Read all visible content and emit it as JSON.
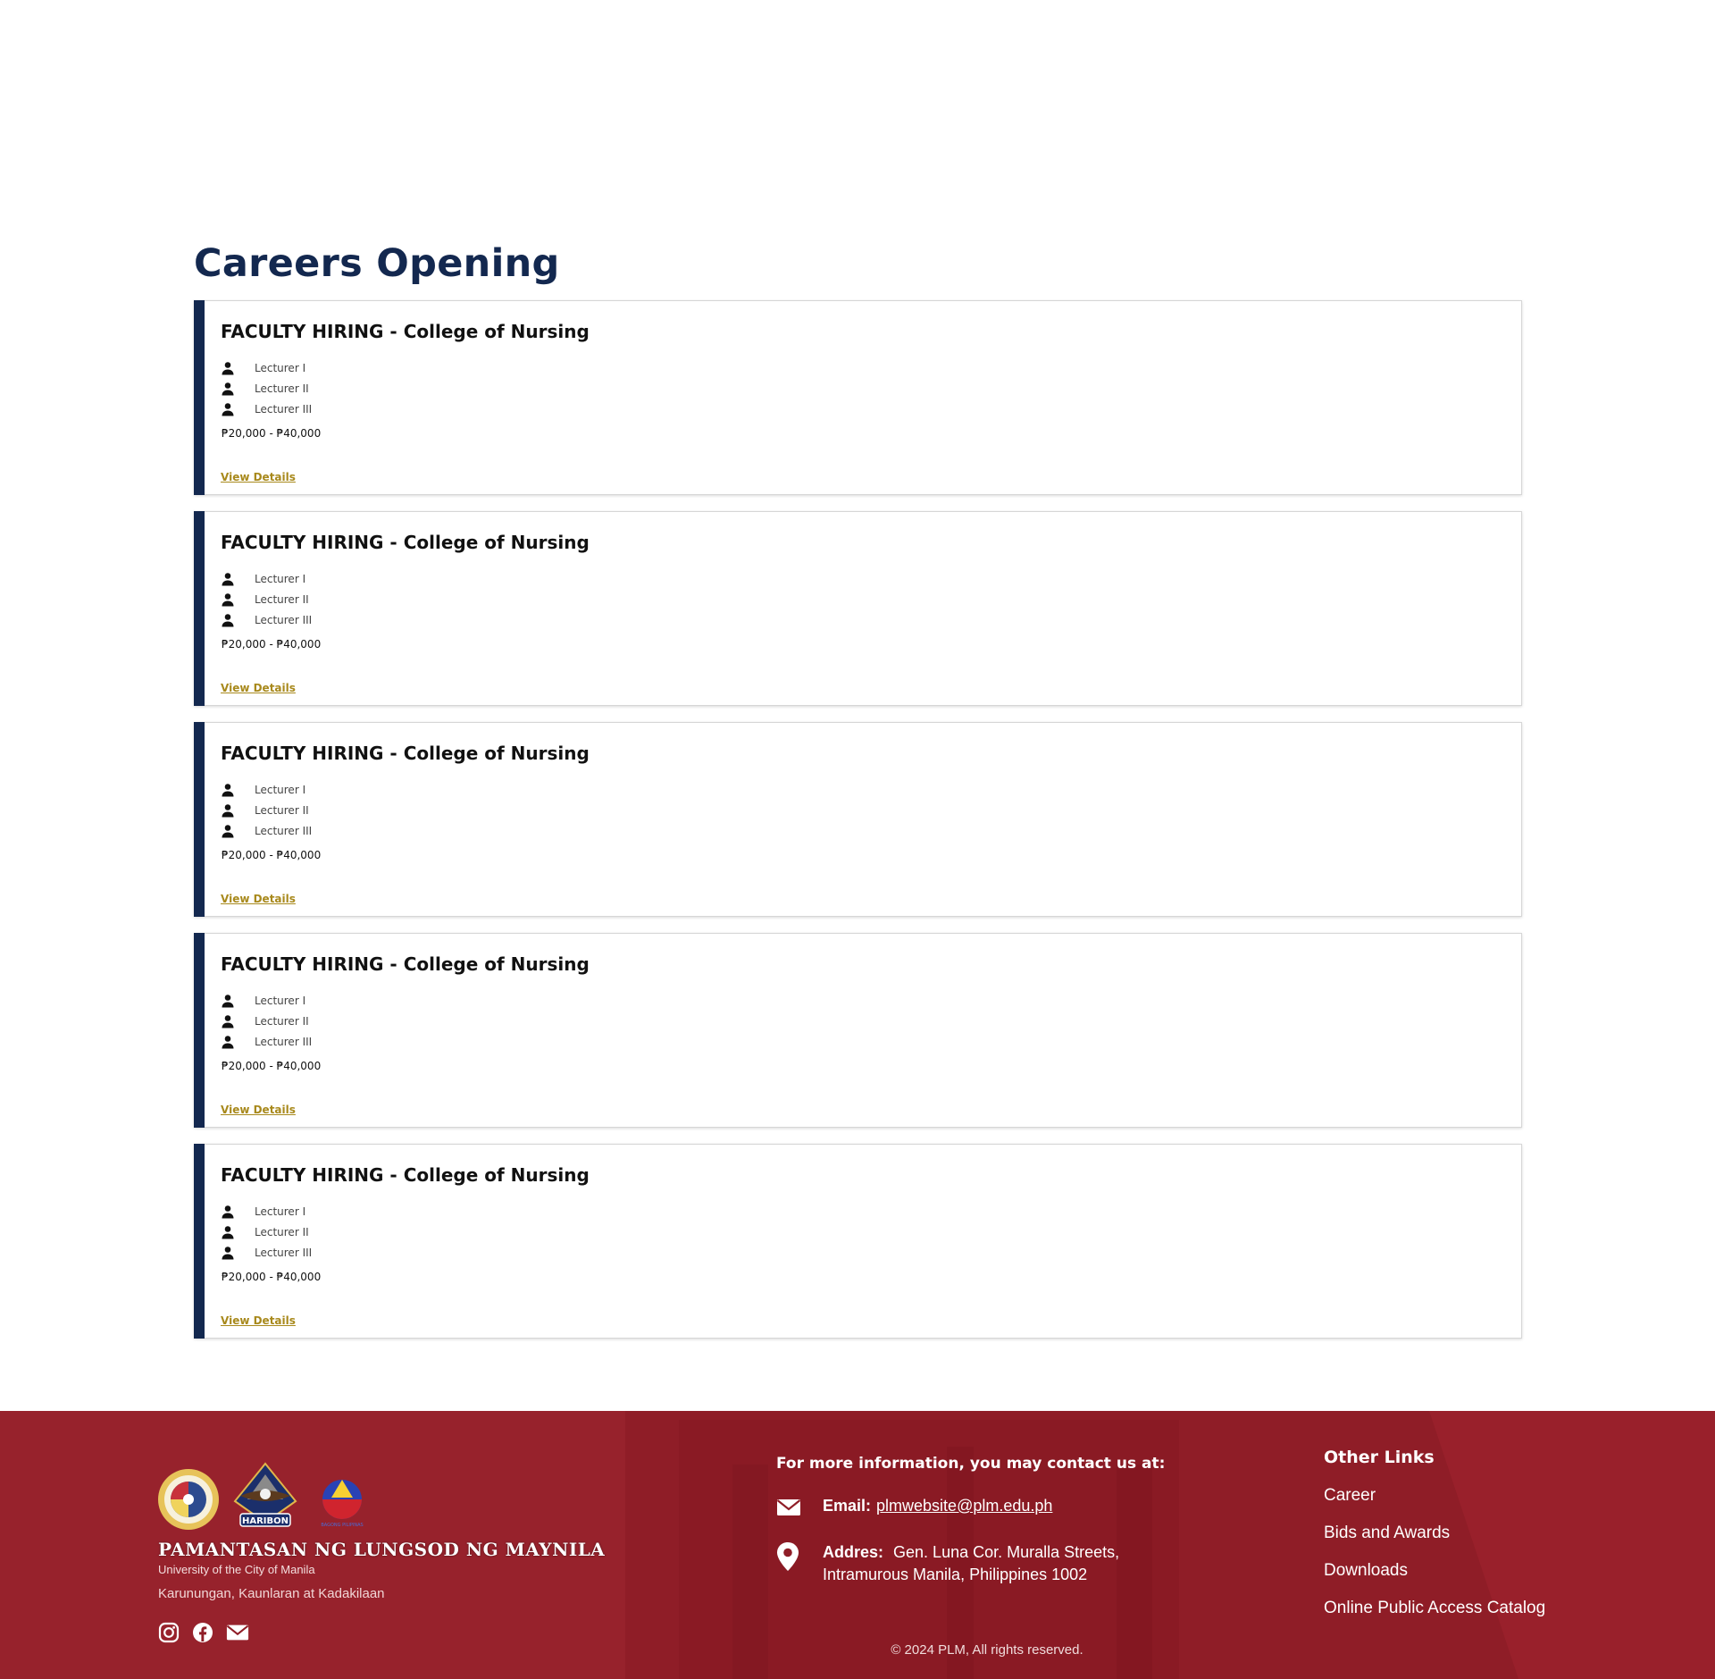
{
  "page": {
    "title": "Careers Opening"
  },
  "jobs": [
    {
      "title": "FACULTY HIRING - College of Nursing",
      "positions": [
        "Lecturer I",
        "Lecturer II",
        "Lecturer III"
      ],
      "salary": "₱20,000 - ₱40,000",
      "link_label": "View Details"
    },
    {
      "title": "FACULTY HIRING - College of Nursing",
      "positions": [
        "Lecturer I",
        "Lecturer II",
        "Lecturer III"
      ],
      "salary": "₱20,000 - ₱40,000",
      "link_label": "View Details"
    },
    {
      "title": "FACULTY HIRING - College of Nursing",
      "positions": [
        "Lecturer I",
        "Lecturer II",
        "Lecturer III"
      ],
      "salary": "₱20,000 - ₱40,000",
      "link_label": "View Details"
    },
    {
      "title": "FACULTY HIRING - College of Nursing",
      "positions": [
        "Lecturer I",
        "Lecturer II",
        "Lecturer III"
      ],
      "salary": "₱20,000 - ₱40,000",
      "link_label": "View Details"
    },
    {
      "title": "FACULTY HIRING - College of Nursing",
      "positions": [
        "Lecturer I",
        "Lecturer II",
        "Lecturer III"
      ],
      "salary": "₱20,000 - ₱40,000",
      "link_label": "View Details"
    }
  ],
  "footer": {
    "university_name": "PAMANTASAN NG LUNGSOD NG MAYNILA",
    "university_subtitle": "University of the City of Manila",
    "motto": "Karunungan, Kaunlaran at Kadakilaan",
    "logos": [
      "plm-seal-logo",
      "plm-haribon-logo",
      "bagong-pilipinas-logo"
    ],
    "logo_text": {
      "haribon": "HARIBON",
      "bagong_pilipinas": "BAGONG PILIPINAS"
    },
    "socials": [
      "instagram-icon",
      "facebook-icon",
      "mail-icon"
    ],
    "contact_heading": "For more information, you may contact us at:",
    "email_label": "Email:",
    "email": "plmwebsite@plm.edu.ph",
    "address_label": "Addres:",
    "address_line1": "Gen. Luna Cor. Muralla Streets,",
    "address_line2": "Intramurous Manila, Philippines 1002",
    "links_heading": "Other Links",
    "links": [
      "Career",
      "Bids and Awards",
      "Downloads",
      "Online Public Access Catalog"
    ],
    "copyright": "© 2024 PLM, All rights reserved."
  },
  "colors": {
    "navy": "#13284f",
    "gold_link": "#a8891c",
    "footer_red": "#941f2a"
  }
}
